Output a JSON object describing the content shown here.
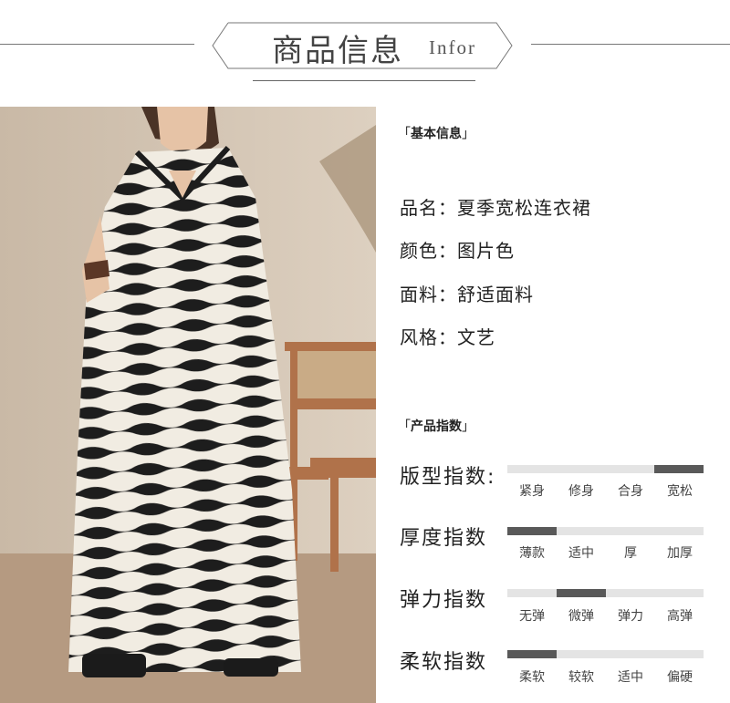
{
  "header": {
    "title": "商品信息",
    "subtitle": "Infor"
  },
  "basic_info": {
    "section_title": "基本信息",
    "rows": [
      {
        "label": "品名：",
        "value": "夏季宽松连衣裙"
      },
      {
        "label": "颜色：",
        "value": "图片色"
      },
      {
        "label": "面料：",
        "value": "舒适面料"
      },
      {
        "label": "风格：",
        "value": "文艺"
      }
    ]
  },
  "product_index": {
    "section_title": "产品指数",
    "indices": [
      {
        "label": "版型指数:",
        "options": [
          "紧身",
          "修身",
          "合身",
          "宽松"
        ],
        "selected_index": 3
      },
      {
        "label": "厚度指数",
        "options": [
          "薄款",
          "适中",
          "厚",
          "加厚"
        ],
        "selected_index": 0
      },
      {
        "label": "弹力指数",
        "options": [
          "无弹",
          "微弹",
          "弹力",
          "高弹"
        ],
        "selected_index": 1
      },
      {
        "label": "柔软指数",
        "options": [
          "柔软",
          "较软",
          "适中",
          "偏硬"
        ],
        "selected_index": 0
      }
    ]
  },
  "colors": {
    "accent_bar": "#595959",
    "track": "#e4e4e4"
  }
}
